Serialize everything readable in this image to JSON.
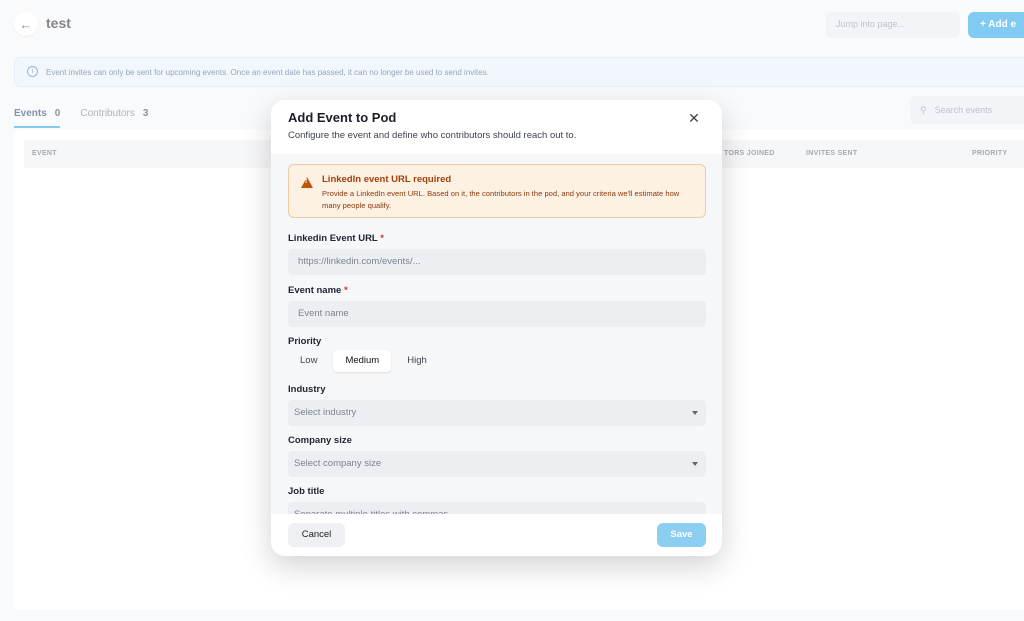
{
  "page": {
    "back_icon": "arrow-left-icon",
    "title": "test",
    "jump_placeholder": "Jump into page...",
    "add_button_label": "+ Add e",
    "notice": "Event invites can only be sent for upcoming events. Once an event date has passed, it can no longer be used to send invites.",
    "tabs": [
      {
        "label": "Events",
        "count": "0"
      },
      {
        "label": "Contributors",
        "count": "3"
      }
    ],
    "search_placeholder": "Search events",
    "table_headers": [
      "EVENT",
      "TORS JOINED",
      "INVITES SENT",
      "PRIORITY"
    ]
  },
  "modal": {
    "title": "Add Event to Pod",
    "subtitle": "Configure the event and define who contributors should reach out to.",
    "close_icon": "close-icon",
    "warning": {
      "title": "LinkedIn event URL required",
      "text": "Provide a LinkedIn event URL. Based on it, the contributors in the pod, and your criteria we'll estimate how many people qualify."
    },
    "fields": {
      "linkedin_label": "Linkedin Event URL",
      "linkedin_placeholder": "https://linkedin.com/events/...",
      "event_name_label": "Event name",
      "event_name_placeholder": "Event name",
      "priority_label": "Priority",
      "priority_options": [
        "Low",
        "Medium",
        "High"
      ],
      "priority_selected": "Medium",
      "industry_label": "Industry",
      "industry_placeholder": "Select industry",
      "company_size_label": "Company size",
      "company_size_placeholder": "Select company size",
      "job_title_label": "Job title",
      "job_title_placeholder": "Separate multiple titles with commas"
    },
    "required_marker": "*",
    "cancel_label": "Cancel",
    "save_label": "Save"
  },
  "colors": {
    "accent": "#1a9fe8",
    "save_disabled": "#8ccdf2",
    "warning_bg": "#fdf1e4",
    "warning_text": "#a3410b"
  }
}
